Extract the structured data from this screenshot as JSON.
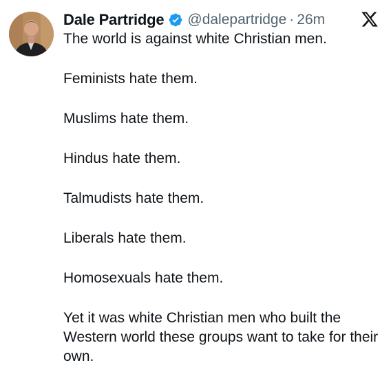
{
  "author": {
    "display_name": "Dale Partridge",
    "handle": "@dalepartridge",
    "separator": "·",
    "timestamp": "26m",
    "verified": true
  },
  "colors": {
    "text": "#0f1419",
    "muted": "#536471",
    "verified_badge": "#1d9bf0"
  },
  "icons": {
    "verified": "verified-badge-icon",
    "brand": "x-logo-icon"
  },
  "tweet": {
    "lines": [
      "The world is against white Christian men.",
      "Feminists hate them.",
      "Muslims hate them.",
      "Hindus hate them.",
      "Talmudists hate them.",
      "Liberals hate them.",
      "Homosexuals hate them.",
      "Yet it was white Christian men who built the Western world these groups want to take for their own."
    ]
  }
}
